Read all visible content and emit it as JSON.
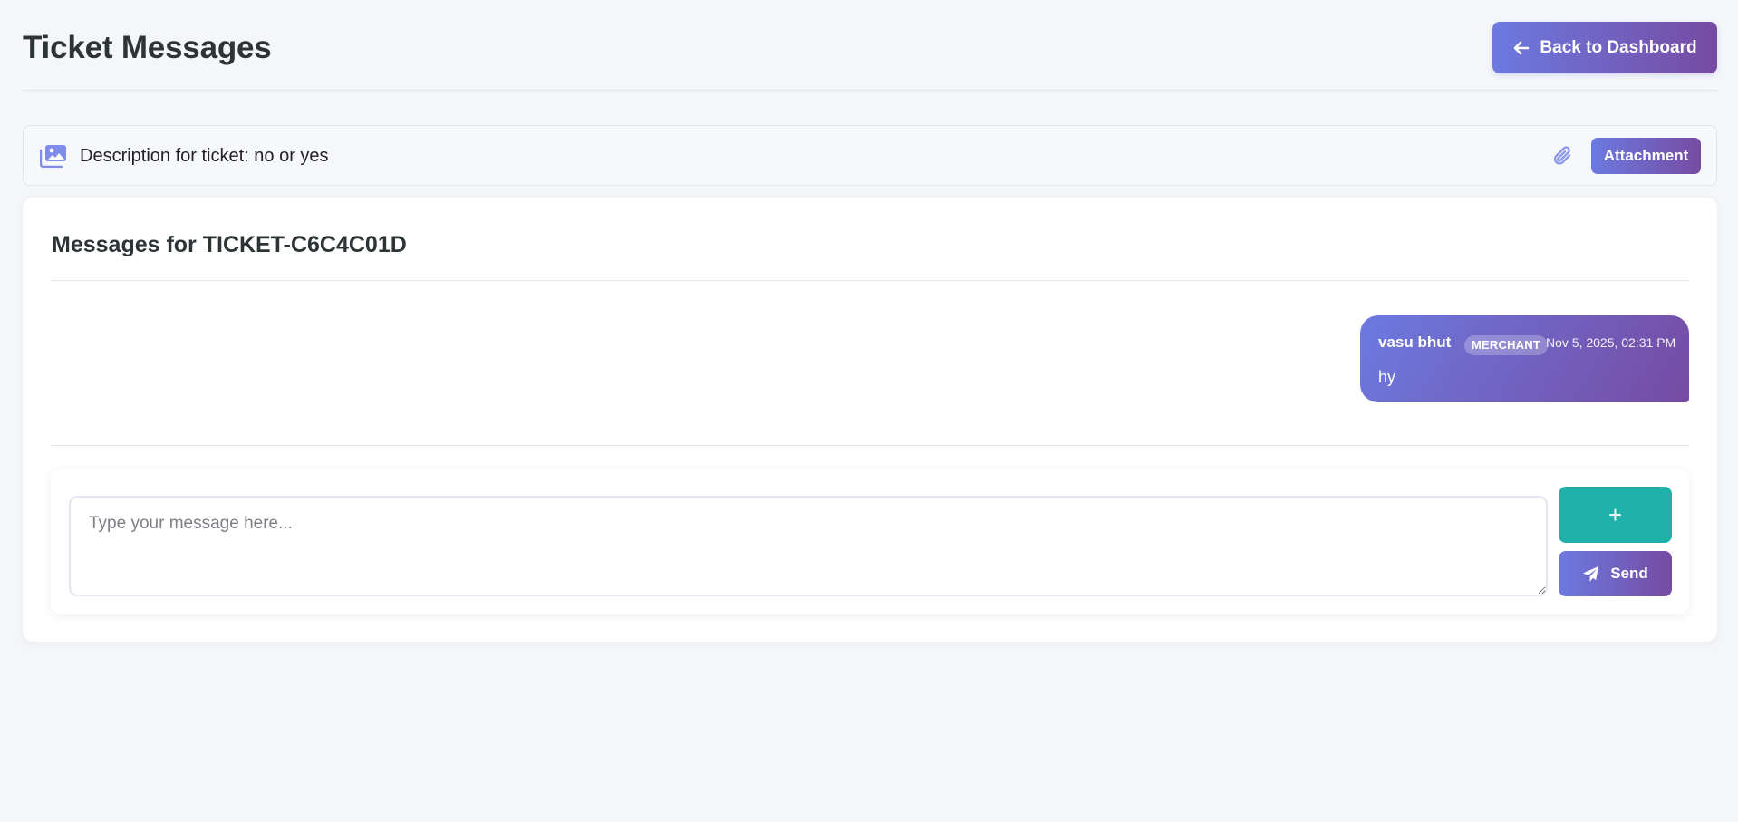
{
  "header": {
    "title": "Ticket Messages",
    "back_label": "Back to Dashboard",
    "back_icon": "arrow-left-icon"
  },
  "description_bar": {
    "icon": "images-icon",
    "text": "Description for ticket: no or yes",
    "attachment_icon": "paperclip-icon",
    "attachment_label": "Attachment"
  },
  "messages_panel": {
    "title": "Messages for TICKET-C6C4C01D",
    "messages": [
      {
        "sender": "vasu bhut",
        "role": "MERCHANT",
        "timestamp": "Nov 5, 2025, 02:31 PM",
        "text": "hy"
      }
    ]
  },
  "composer": {
    "placeholder": "Type your message here...",
    "value": "",
    "add_label": "+",
    "send_label": "Send",
    "send_icon": "paper-plane-icon"
  },
  "colors": {
    "background": "#f5f6fa",
    "accent_gradient_start": "#6c7ae0",
    "accent_gradient_end": "#764ba2",
    "teal": "#20b2aa",
    "text": "#2d3436"
  }
}
